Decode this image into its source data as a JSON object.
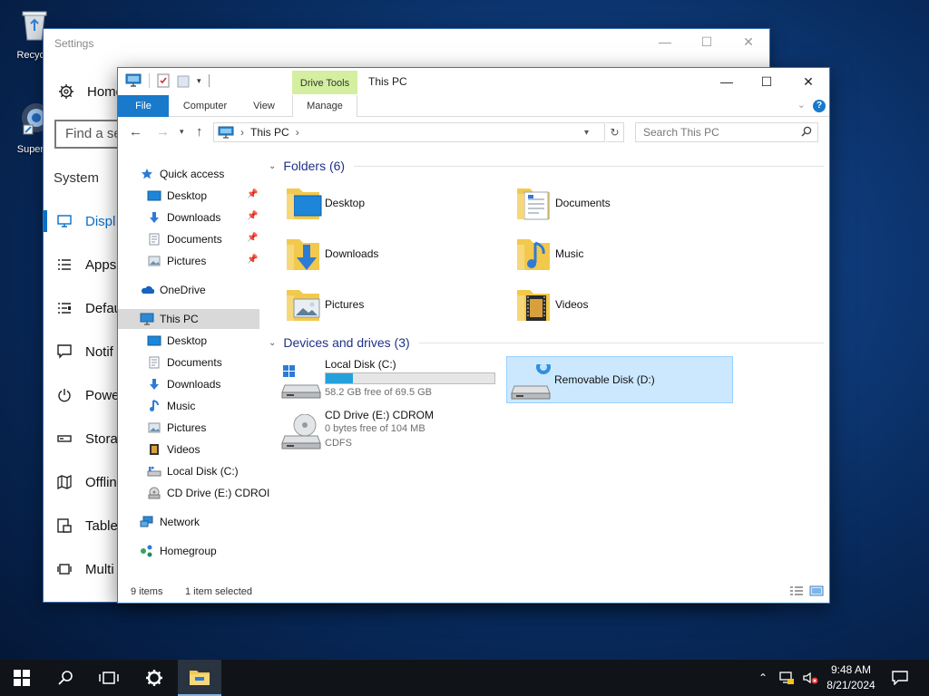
{
  "desktop": {
    "icons": [
      {
        "label": "Recycle",
        "icon": "recycle-bin-icon"
      },
      {
        "label": "Superm",
        "icon": "supermium-browser-icon"
      }
    ]
  },
  "settings": {
    "title": "Settings",
    "home": "Home",
    "find_placeholder": "Find a se",
    "section": "System",
    "items": [
      {
        "label": "Displ",
        "icon": "monitor-icon",
        "active": true
      },
      {
        "label": "Apps",
        "icon": "list-icon"
      },
      {
        "label": "Defau",
        "icon": "list-icon"
      },
      {
        "label": "Notif",
        "icon": "notification-icon"
      },
      {
        "label": "Powe",
        "icon": "power-icon"
      },
      {
        "label": "Stora",
        "icon": "storage-icon"
      },
      {
        "label": "Offlin",
        "icon": "map-icon"
      },
      {
        "label": "Table",
        "icon": "tablet-icon"
      },
      {
        "label": "Multi",
        "icon": "multitask-icon"
      }
    ]
  },
  "explorer": {
    "title": "This PC",
    "context_tab_group": "Drive Tools",
    "tabs": {
      "file": "File",
      "computer": "Computer",
      "view": "View",
      "manage": "Manage"
    },
    "address": {
      "location": "This PC"
    },
    "search_placeholder": "Search This PC",
    "nav": {
      "quick_access": "Quick access",
      "quick_items": [
        {
          "label": "Desktop",
          "icon": "desktop-folder-icon",
          "pinned": true
        },
        {
          "label": "Downloads",
          "icon": "downloads-icon",
          "pinned": true
        },
        {
          "label": "Documents",
          "icon": "documents-icon",
          "pinned": true
        },
        {
          "label": "Pictures",
          "icon": "pictures-icon",
          "pinned": true
        }
      ],
      "onedrive": "OneDrive",
      "this_pc": "This PC",
      "pc_items": [
        {
          "label": "Desktop",
          "icon": "desktop-folder-icon"
        },
        {
          "label": "Documents",
          "icon": "documents-icon"
        },
        {
          "label": "Downloads",
          "icon": "downloads-icon"
        },
        {
          "label": "Music",
          "icon": "music-icon"
        },
        {
          "label": "Pictures",
          "icon": "pictures-icon"
        },
        {
          "label": "Videos",
          "icon": "videos-icon"
        },
        {
          "label": "Local Disk (C:)",
          "icon": "local-disk-icon"
        },
        {
          "label": "CD Drive (E:) CDROI",
          "icon": "cd-drive-icon"
        }
      ],
      "network": "Network",
      "homegroup": "Homegroup"
    },
    "folders_header": "Folders (6)",
    "folders": [
      {
        "label": "Desktop",
        "icon": "desktop-folder-icon"
      },
      {
        "label": "Documents",
        "icon": "documents-folder-icon"
      },
      {
        "label": "Downloads",
        "icon": "downloads-folder-icon"
      },
      {
        "label": "Music",
        "icon": "music-folder-icon"
      },
      {
        "label": "Pictures",
        "icon": "pictures-folder-icon"
      },
      {
        "label": "Videos",
        "icon": "videos-folder-icon"
      }
    ],
    "devices_header": "Devices and drives (3)",
    "drives": [
      {
        "label": "Local Disk (C:)",
        "free_text": "58.2 GB free of 69.5 GB",
        "used_fraction": 0.163
      },
      {
        "label": "CD Drive (E:) CDROM",
        "free_text": "0 bytes free of 104 MB",
        "filesystem": "CDFS"
      },
      {
        "label": "Removable Disk (D:)",
        "selected": true
      }
    ],
    "status": {
      "count": "9 items",
      "selection": "1 item selected"
    }
  },
  "taskbar": {
    "time": "9:48 AM",
    "date": "8/21/2024"
  },
  "colors": {
    "accent": "#1979ca",
    "drive_tools": "#d3ef9f",
    "selection": "#cce8ff",
    "disk_bar": "#26a0da"
  }
}
